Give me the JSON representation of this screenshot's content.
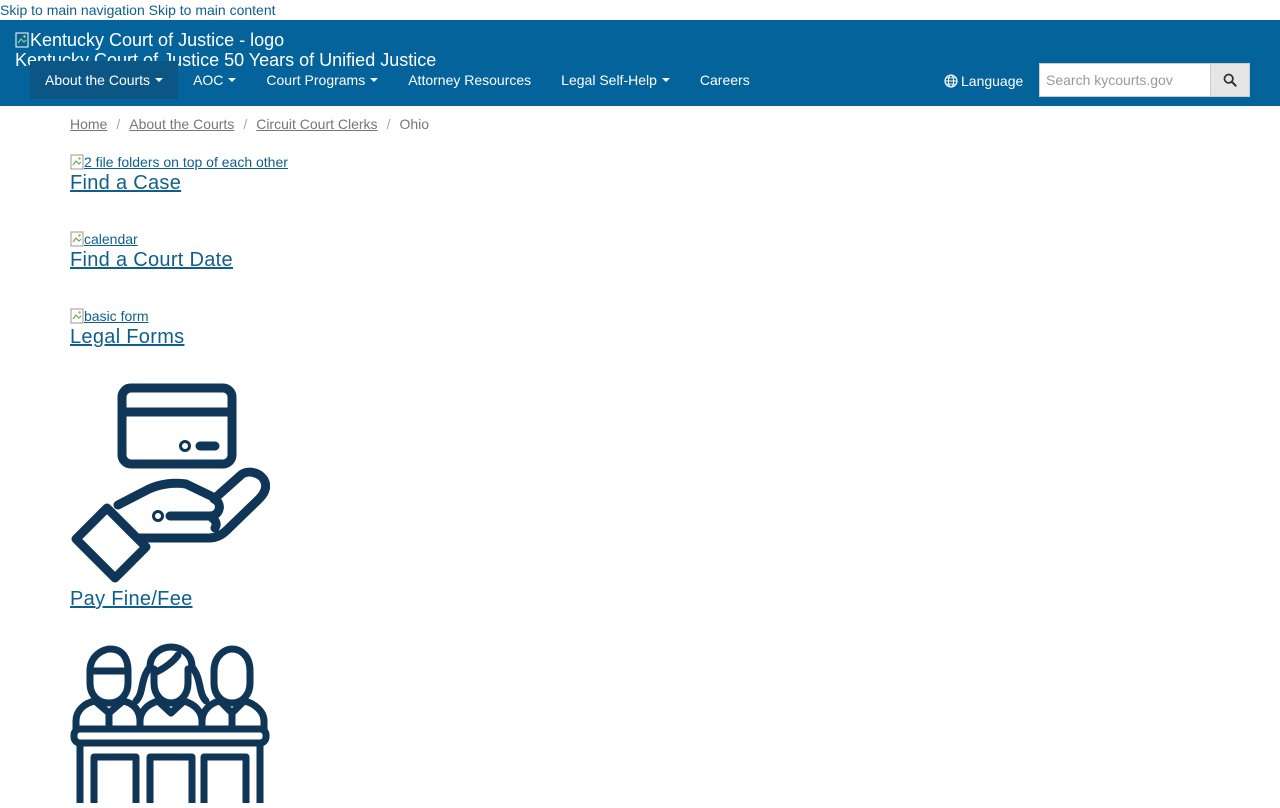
{
  "skip_links": {
    "nav": "Skip to main navigation",
    "content": "Skip to main content"
  },
  "header": {
    "logo_alt": "Kentucky Court of Justice - logo",
    "site_title": "Kentucky Court of Justice 50 Years of Unified Justice",
    "colors": {
      "header_bg": "#03639a",
      "active_nav_bg": "#0b5685",
      "link": "#0e5f8c",
      "icon_navy": "#0f3557"
    }
  },
  "nav": {
    "items": [
      {
        "label": "About the Courts",
        "dropdown": true,
        "active": true
      },
      {
        "label": "AOC",
        "dropdown": true
      },
      {
        "label": "Court Programs",
        "dropdown": true
      },
      {
        "label": "Attorney Resources",
        "dropdown": false
      },
      {
        "label": "Legal Self-Help",
        "dropdown": true
      },
      {
        "label": "Careers",
        "dropdown": false
      }
    ],
    "language": "Language",
    "language_icon": "globe-icon"
  },
  "search": {
    "placeholder": "Search kycourts.gov",
    "value": "",
    "icon": "search-icon"
  },
  "breadcrumb": {
    "items": [
      "Home",
      "About the Courts",
      "Circuit Court Clerks"
    ],
    "current": "Ohio"
  },
  "quick_links": [
    {
      "img_alt": "2 file folders on top of each other",
      "label": "Find a Case"
    },
    {
      "img_alt": "calendar",
      "label": "Find a Court Date"
    },
    {
      "img_alt": "basic form",
      "label": "Legal Forms"
    },
    {
      "icon": "hand-holding-card-icon",
      "label": "Pay Fine/Fee"
    },
    {
      "icon": "jury-box-icon"
    }
  ]
}
